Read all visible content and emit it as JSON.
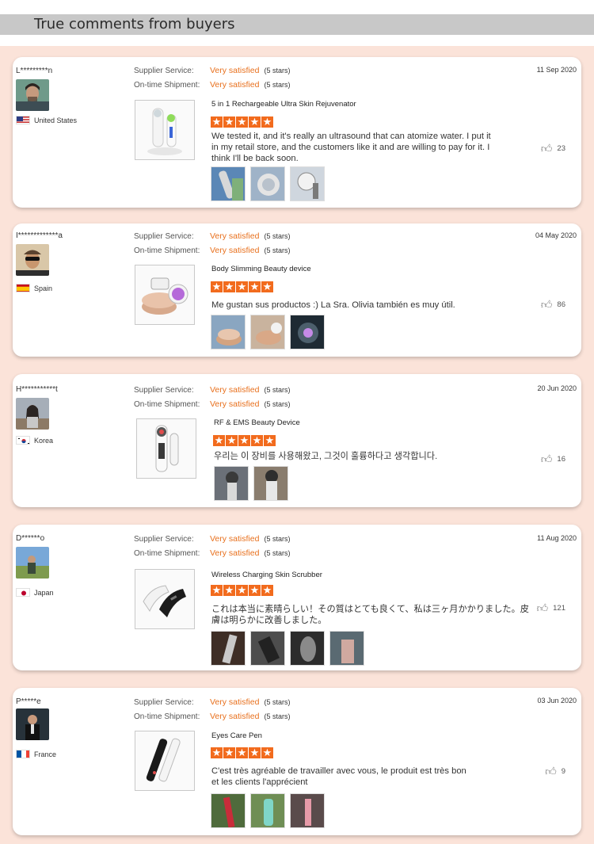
{
  "header": {
    "title": "True comments from buyers"
  },
  "reviews": [
    {
      "user": "L*********n",
      "country": "United States",
      "supplier_label": "Supplier Service:",
      "supplier_value": "Very satisfied",
      "supplier_stars": "(5 stars)",
      "shipment_label": "On-time Shipment:",
      "shipment_value": "Very satisfied",
      "shipment_stars": "(5 stars)",
      "date": "11 Sep 2020",
      "product": "5 in 1 Rechargeable Ultra Skin Rejuvenator",
      "rating": 5,
      "comment": "We tested it, and it's really an ultrasound that can atomize water. I put it in my retail store, and the customers like it and are willing to pay for it. I think I'll be back soon.",
      "likes": "23",
      "photo_count": 3
    },
    {
      "user": "I*************a",
      "country": "Spain",
      "supplier_label": "Supplier Service:",
      "supplier_value": "Very satisfied",
      "supplier_stars": "(5 stars)",
      "shipment_label": "On-time Shipment:",
      "shipment_value": "Very satisfied",
      "shipment_stars": "(5 stars)",
      "date": "04 May 2020",
      "product": "Body Slimming Beauty device",
      "rating": 5,
      "comment": "Me gustan sus productos :) La Sra. Olivia también es muy útil.",
      "likes": "86",
      "photo_count": 3
    },
    {
      "user": "H***********t",
      "country": "Korea",
      "supplier_label": "Supplier Service:",
      "supplier_value": "Very satisfied",
      "supplier_stars": "(5 stars)",
      "shipment_label": "On-time Shipment:",
      "shipment_value": "Very satisfied",
      "shipment_stars": "(5 stars)",
      "date": "20 Jun 2020",
      "product": "RF & EMS Beauty Device",
      "rating": 5,
      "comment": "우리는 이 장비를 사용해왔고, 그것이 훌륭하다고 생각합니다.",
      "likes": "16",
      "photo_count": 2
    },
    {
      "user": "D******o",
      "country": "Japan",
      "supplier_label": "Supplier Service:",
      "supplier_value": "Very satisfied",
      "supplier_stars": "(5 stars)",
      "shipment_label": "On-time Shipment:",
      "shipment_value": "Very satisfied",
      "shipment_stars": "(5 stars)",
      "date": "11 Aug 2020",
      "product": "Wireless Charging Skin Scrubber",
      "rating": 5,
      "comment": "これは本当に素晴らしい！その質はとても良くて、私は三ヶ月かかりました。皮膚は明らかに改善しました。",
      "likes": "121",
      "photo_count": 4
    },
    {
      "user": "P*****e",
      "country": "France",
      "supplier_label": "Supplier Service:",
      "supplier_value": "Very satisfied",
      "supplier_stars": "(5 stars)",
      "shipment_label": "On-time Shipment:",
      "shipment_value": "Very satisfied",
      "shipment_stars": "(5 stars)",
      "date": "03 Jun 2020",
      "product": "Eyes Care Pen",
      "rating": 5,
      "comment": "C'est très agréable de travailler avec vous, le produit est très bon et les clients l'apprécient",
      "likes": "9",
      "photo_count": 3
    }
  ]
}
